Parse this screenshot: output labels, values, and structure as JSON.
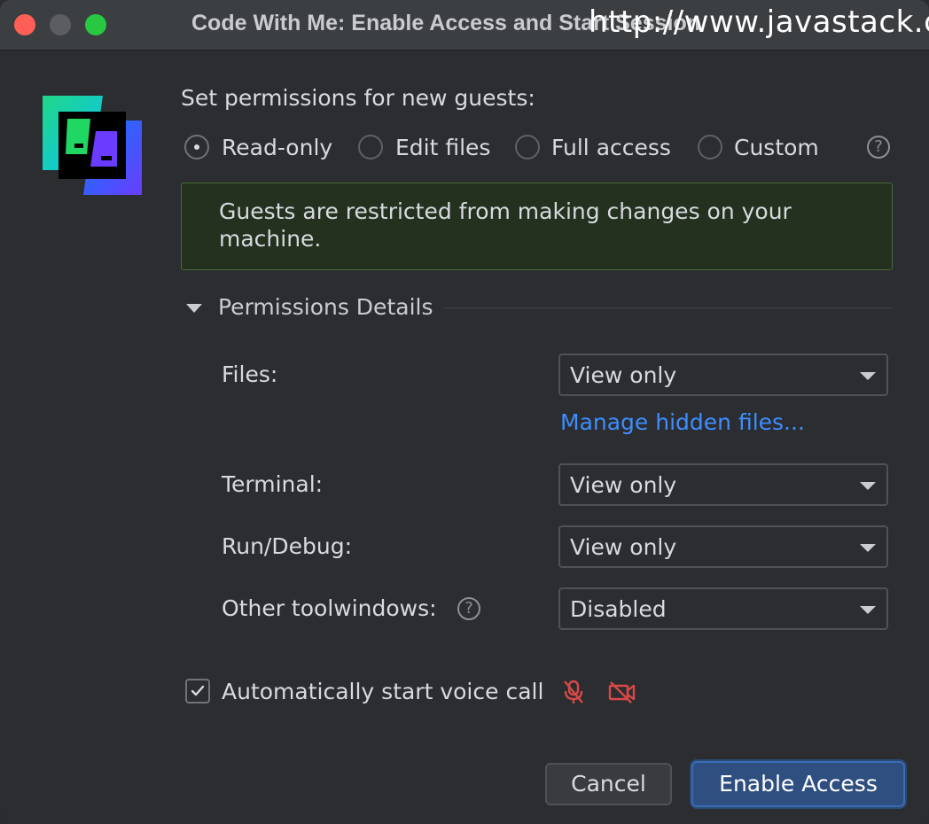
{
  "window": {
    "title": "Code With Me: Enable Access and Start Session",
    "watermark": "http://www.javastack.cn"
  },
  "permissions": {
    "heading": "Set permissions for new guests:",
    "options": [
      "Read-only",
      "Edit files",
      "Full access",
      "Custom"
    ],
    "selected": "Read-only",
    "info_text": "Guests are restricted from making changes on your machine."
  },
  "details": {
    "header": "Permissions Details",
    "expanded": true,
    "files_label": "Files:",
    "files_value": "View only",
    "manage_link": "Manage hidden files...",
    "terminal_label": "Terminal:",
    "terminal_value": "View only",
    "rundebug_label": "Run/Debug:",
    "rundebug_value": "View only",
    "toolwindows_label": "Other toolwindows:",
    "toolwindows_value": "Disabled"
  },
  "voice": {
    "label": "Automatically start voice call",
    "checked": true
  },
  "buttons": {
    "cancel": "Cancel",
    "enable": "Enable Access"
  },
  "colors": {
    "background": "#2b2d30",
    "info_bg": "#24311f",
    "link": "#3d8eff",
    "primary": "#2e4f80",
    "muted_icon": "#d94848"
  },
  "icons": {
    "logo": "code-with-me-logo",
    "help": "question-mark-icon",
    "mic": "microphone-off-icon",
    "camera": "camera-off-icon"
  }
}
